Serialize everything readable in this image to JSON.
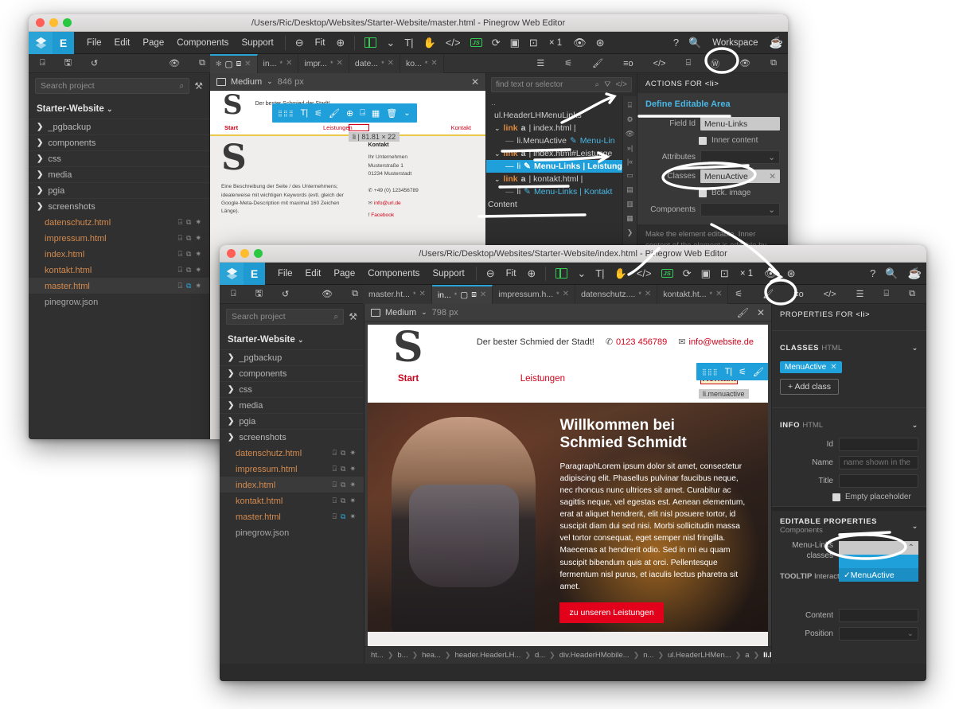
{
  "app": {
    "name": "Pinegrow Web Editor"
  },
  "window1": {
    "title": "/Users/Ric/Desktop/Websites/Starter-Website/master.html - Pinegrow Web Editor",
    "menu": [
      "File",
      "Edit",
      "Page",
      "Components",
      "Support"
    ],
    "zoom_label": "Fit",
    "multiplier": "× 1",
    "workspace_label": "Workspace",
    "tabs": [
      {
        "label": "in...",
        "modified": "*"
      },
      {
        "label": "impr...",
        "modified": "*"
      },
      {
        "label": "date...",
        "modified": "*"
      },
      {
        "label": "ko...",
        "modified": "*"
      }
    ],
    "project": {
      "search_placeholder": "Search project",
      "name": "Starter-Website",
      "folders": [
        "_pgbackup",
        "components",
        "css",
        "media",
        "pgia",
        "screenshots"
      ],
      "files": [
        "datenschutz.html",
        "impressum.html",
        "index.html",
        "kontakt.html",
        "master.html"
      ],
      "selected_file": "master.html",
      "plain_file": "pinegrow.json"
    },
    "preview": {
      "breakpoint": "Medium",
      "width": "846 px",
      "tagline": "Der bester Schmied der Stadt!",
      "nav": [
        "Start",
        "Leistungen",
        "Kontakt"
      ],
      "selection_size": "li  |  81.81 × 22",
      "selection_tag": "Leistungen",
      "footer_heading": "Kontakt",
      "footer_address": "Ihr Unternehmen\nMusterstraße 1\n01234 Musterstadt",
      "footer_phone": "+49 (0) 123456789",
      "footer_mail": "info@url.de",
      "footer_social": "Facebook",
      "footer_desc": "Eine Beschreibung der Seite / des Unternehmens; idealerweise mit wichtigen Keywords (evtl. gleich der Google-Meta-Description mit maximal 160 Zeichen Länge)."
    },
    "tree": {
      "search_placeholder": "find text or selector",
      "dots": "..",
      "root": "ul.HeaderLHMenuLinks",
      "nodes": [
        {
          "type": "link",
          "tag": "a",
          "text": "| index.html |"
        },
        {
          "type": "child",
          "tag": "li.MenuActive",
          "text": "Menu-Lin",
          "selected": false
        },
        {
          "type": "link",
          "tag": "a",
          "text": "| index.html#Leistunge"
        },
        {
          "type": "child",
          "tag": "li",
          "text": "Menu-Links | Leistung",
          "selected": true
        },
        {
          "type": "link",
          "tag": "a",
          "text": "| kontakt.html |"
        },
        {
          "type": "child",
          "tag": "li",
          "text": "Menu-Links | Kontakt",
          "selected": false
        }
      ],
      "footer_node": "Content"
    },
    "actions": {
      "header": "ACTIONS FOR",
      "header_tag": "<li>",
      "title": "Define Editable Area",
      "field_id_label": "Field Id",
      "field_id_value": "Menu-Links",
      "inner_content_label": "Inner content",
      "attributes_label": "Attributes",
      "classes_label": "Classes",
      "classes_value": "MenuActive",
      "bck_image_label": "Bck. image",
      "components_label": "Components",
      "help": "Make the element editable. Inner content of the element is editable by default. ⓘ"
    }
  },
  "window2": {
    "title": "/Users/Ric/Desktop/Websites/Starter-Website/index.html - Pinegrow Web Editor",
    "menu": [
      "File",
      "Edit",
      "Page",
      "Components",
      "Support"
    ],
    "zoom_label": "Fit",
    "multiplier": "× 1",
    "tabs": [
      {
        "label": "master.ht...",
        "modified": "*",
        "active": false
      },
      {
        "label": "in...",
        "modified": "*",
        "active": true
      },
      {
        "label": "impressum.h...",
        "modified": "*",
        "active": false
      },
      {
        "label": "datenschutz....",
        "modified": "*",
        "active": false
      },
      {
        "label": "kontakt.ht...",
        "modified": "*",
        "active": false
      }
    ],
    "project": {
      "search_placeholder": "Search project",
      "name": "Starter-Website",
      "folders": [
        "_pgbackup",
        "components",
        "css",
        "media",
        "pgia",
        "screenshots"
      ],
      "files": [
        "datenschutz.html",
        "impressum.html",
        "index.html",
        "kontakt.html",
        "master.html"
      ],
      "selected_file": "index.html",
      "plain_file": "pinegrow.json"
    },
    "preview": {
      "breakpoint": "Medium",
      "width": "798 px",
      "tagline": "Der bester Schmied der Stadt!",
      "phone": "0123 456789",
      "mail": "info@website.de",
      "nav": [
        "Start",
        "Leistungen",
        "Kontakt"
      ],
      "selection_tag": "li.menuactive",
      "hero_title_line1": "Willkommen bei",
      "hero_title_line2": "Schmied Schmidt",
      "hero_paragraph": "ParagraphLorem ipsum dolor sit amet, consectetur adipiscing elit. Phasellus pulvinar faucibus neque, nec rhoncus nunc ultrices sit amet. Curabitur ac sagittis neque, vel egestas est. Aenean elementum, erat at aliquet hendrerit, elit nisl posuere tortor, id suscipit diam dui sed nisi. Morbi sollicitudin massa vel tortor consequat, eget semper nisl fringilla. Maecenas at hendrerit odio. Sed in mi eu quam suscipit bibendum quis at orci. Pellentesque fermentum nisl purus, et iaculis lectus pharetra sit amet.",
      "hero_button": "zu unseren Leistungen"
    },
    "properties": {
      "header": "PROPERTIES FOR",
      "header_tag": "<li>",
      "classes_section": "CLASSES",
      "classes_section_sub": "HTML",
      "class_chip": "MenuActive",
      "add_class": "+ Add class",
      "info_section": "INFO",
      "info_section_sub": "HTML",
      "id_label": "Id",
      "id_value": "",
      "name_label": "Name",
      "name_placeholder": "name shown in the",
      "title_label": "Title",
      "title_value": "",
      "empty_placeholder_label": "Empty placeholder",
      "editable_section": "EDITABLE PROPERTIES",
      "editable_section_sub": "Components",
      "menu_links_label_l1": "Menu-Links",
      "menu_links_label_l2": "classes",
      "dropdown_option": "✓MenuActive",
      "tooltip_section": "TOOLTIP",
      "tooltip_section_sub": "Interact",
      "content_label": "Content",
      "position_label": "Position"
    },
    "breadcrumb": [
      "ht...",
      "b...",
      "hea...",
      "header.HeaderLH...",
      "d...",
      "div.HeaderHMobile...",
      "n...",
      "ul.HeaderLHMen...",
      "a",
      "li.MenuA..."
    ]
  },
  "colors": {
    "accent_blue": "#1fa0da",
    "brand_orange": "#d38a4e",
    "red": "#d0021b",
    "hero_red": "#e3001b",
    "green": "#35cc55",
    "panel_dark": "#2e2e2e"
  }
}
